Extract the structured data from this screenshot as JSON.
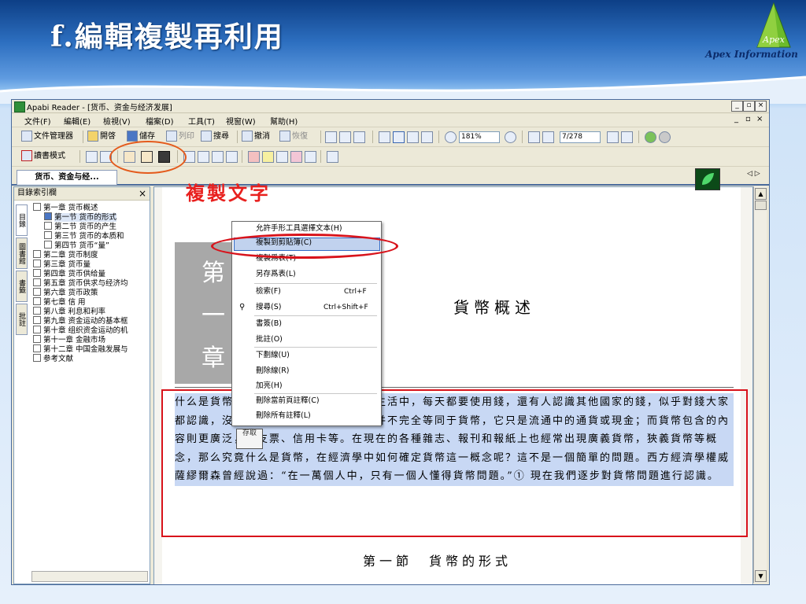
{
  "slide": {
    "title": "f.編輯複製再利用",
    "logo_brand": "Apex",
    "logo_sub": "Apex Information"
  },
  "window": {
    "title": "Apabi Reader - [货币、资金与经济发展]",
    "btn_min": "_",
    "btn_max": "▫",
    "btn_close": "×",
    "mdi_min": "_",
    "mdi_restore": "▫",
    "mdi_close": "×"
  },
  "menu": [
    "文件(F)",
    "編輯(E)",
    "檢視(V)",
    "檔案(D)",
    "工具(T)",
    "視窗(W)",
    "幫助(H)"
  ],
  "toolbar1": {
    "file_manager": "文件管理器",
    "open": "開啓",
    "save": "儲存",
    "print": "列印",
    "search": "搜尋",
    "undo": "撤消",
    "redo": "恢復",
    "zoom": "181%",
    "page": "7/278"
  },
  "toolbar2": {
    "reading_mode": "讀書模式"
  },
  "tabs": {
    "doc_tab": "货币、资金与经...",
    "nav": "◁ ▷"
  },
  "sidebar": {
    "header": "目錄索引欄",
    "close": "×",
    "vtabs": [
      "目錄",
      "圖書館",
      "書籤",
      "批註"
    ],
    "toc": [
      "第一章 货币概述",
      "第一节 货币的形式",
      "第二节 货币的产生",
      "第三节 货币的本质和",
      "第四节 货币“量”",
      "第二章 货币制度",
      "第三章 货币量",
      "第四章 货币供给量",
      "第五章 货币供求与经济均",
      "第六章 货币政策",
      "第七章 信 用",
      "第八章 利息和利率",
      "第九章 资金运动的基本框",
      "第十章 组织资金运动的机",
      "第十一章 金融市场",
      "第十二章 中国金融发展与",
      "参考文献"
    ]
  },
  "page": {
    "chapter_chars": [
      "第",
      "一",
      "章"
    ],
    "heading": "貨幣概述",
    "paragraph": "什么是貨幣？答案是貨幣。我們在日常生活中，每天都要使用錢，還有人認識其他國家的錢，似乎對錢大家都認識，沒有必要再說。但是，錢實際并不完全等同于貨幣，它只是流通中的通貨或現金；而貨幣包含的內容則更廣泛，如支票、信用卡等。在現在的各種雜志、報刊和報紙上也經常出現廣義貨幣，狹義貨幣等概念，那么究竟什么是貨幣，在經濟學中如何確定貨幣這一概念呢？這不是一個簡單的問題。西方經濟學權威薩繆爾森曾經說過：“在一萬個人中，只有一個人懂得貨幣問題。”① 現在我們逐步對貨幣問題進行認識。",
    "section": "第一節　貨幣的形式"
  },
  "annotation": {
    "label": "複製文字"
  },
  "context_menu": {
    "items": [
      {
        "label": "允許手形工具選擇文本(H)",
        "shortcut": ""
      },
      {
        "label": "複製到剪貼簿(C)",
        "shortcut": ""
      },
      {
        "label": "複製爲表(T)",
        "shortcut": ""
      },
      {
        "label": "另存爲表(L)",
        "shortcut": ""
      },
      {
        "label": "檢索(F)",
        "shortcut": "Ctrl+F"
      },
      {
        "label": "搜尋(S)",
        "shortcut": "Ctrl+Shift+F"
      },
      {
        "label": "書簽(B)",
        "shortcut": ""
      },
      {
        "label": "批註(O)",
        "shortcut": ""
      },
      {
        "label": "下劃線(U)",
        "shortcut": ""
      },
      {
        "label": "刪除線(R)",
        "shortcut": ""
      },
      {
        "label": "加亮(H)",
        "shortcut": ""
      },
      {
        "label": "刪除當前頁註釋(C)",
        "shortcut": ""
      },
      {
        "label": "刪除所有註釋(L)",
        "shortcut": ""
      }
    ]
  },
  "stamp": {
    "text": "存取"
  },
  "colors": {
    "accent_red": "#d8131b",
    "highlight_orange": "#e45a1b",
    "selection": "#c8d8f4"
  }
}
